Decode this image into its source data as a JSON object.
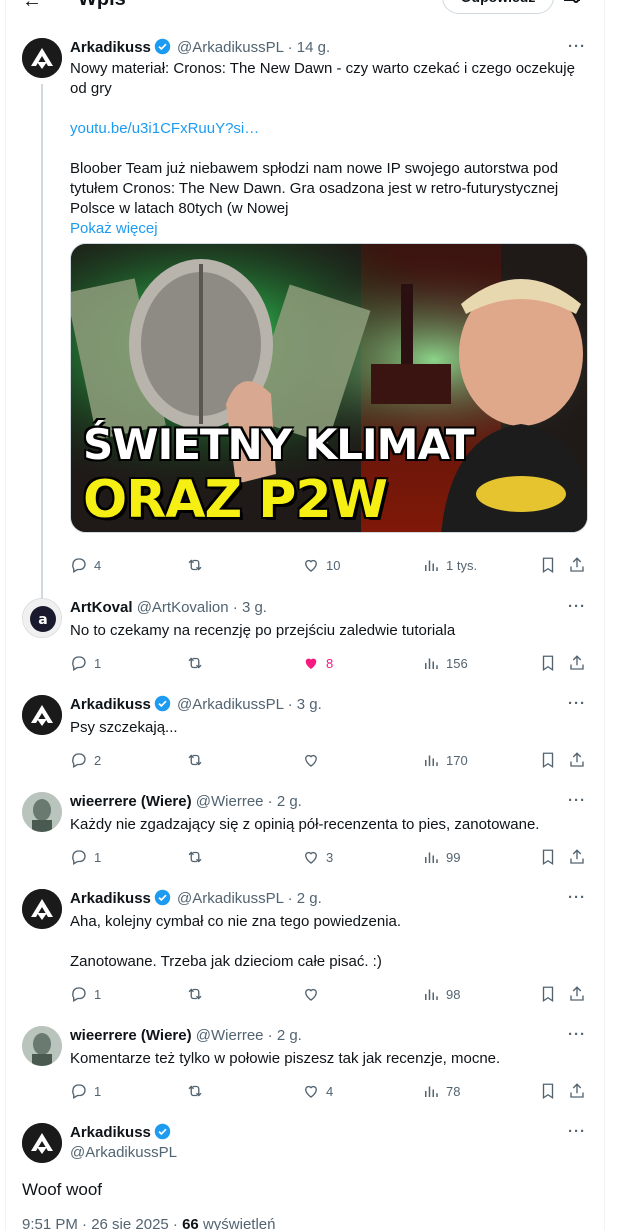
{
  "header": {
    "title": "Wpis",
    "reply_label": "Odpowiedz"
  },
  "icons": {
    "back": "arrow-left-icon",
    "adjust": "sliders-icon",
    "reply": "speech-bubble-icon",
    "repost": "repost-icon",
    "like": "heart-icon",
    "views": "bar-chart-icon",
    "bookmark": "bookmark-icon",
    "share": "share-icon"
  },
  "colors": {
    "accent": "#1d9bf0",
    "like": "#f91880",
    "muted": "#536471"
  },
  "tweets": [
    {
      "name": "Arkadikuss",
      "verified": true,
      "handle": "@ArkadikussPL",
      "time": "· 14 g.",
      "text1": "Nowy materiał: Cronos: The New Dawn - czy warto czekać i czego oczekuję od gry",
      "link": "youtu.be/u3i1CFxRuuY?si…",
      "text2": "Bloober Team już niebawem spłodzi nam nowe IP swojego autorstwa pod tytułem Cronos: The New Dawn. Gra osadzona jest w retro-futurystycznej Polsce w latach 80tych (w Nowej",
      "show_more": "Pokaż więcej",
      "image": {
        "line1": "ŚWIETNY KLIMAT",
        "line2": "ORAZ P2W"
      },
      "replies": "4",
      "reposts": "",
      "likes": "10",
      "views": "1 tys."
    },
    {
      "name": "ArtKoval",
      "verified": false,
      "handle": "@ArtKovalion",
      "time": "· 3 g.",
      "text": "No to czekamy na recenzję po przejściu zaledwie tutoriala",
      "replies": "1",
      "reposts": "",
      "likes": "8",
      "views": "156"
    },
    {
      "name": "Arkadikuss",
      "verified": true,
      "handle": "@ArkadikussPL",
      "time": "· 3 g.",
      "text": "Psy szczekają...",
      "replies": "2",
      "reposts": "",
      "likes": "",
      "views": "170"
    },
    {
      "name": "wieerrere (Wiere)",
      "verified": false,
      "handle": "@Wierree",
      "time": "· 2 g.",
      "text": "Każdy nie zgadzający się z opinią pół-recenzenta to pies, zanotowane.",
      "replies": "1",
      "reposts": "",
      "likes": "3",
      "views": "99"
    },
    {
      "name": "Arkadikuss",
      "verified": true,
      "handle": "@ArkadikussPL",
      "time": "· 2 g.",
      "text1": "Aha, kolejny cymbał co nie zna tego powiedzenia.",
      "text2": "Zanotowane. Trzeba jak dzieciom całe pisać. :)",
      "replies": "1",
      "reposts": "",
      "likes": "",
      "views": "98"
    },
    {
      "name": "wieerrere (Wiere)",
      "verified": false,
      "handle": "@Wierree",
      "time": "· 2 g.",
      "text": "Komentarze też tylko w połowie piszesz tak jak recenzje, mocne.",
      "replies": "1",
      "reposts": "",
      "likes": "4",
      "views": "78"
    }
  ],
  "main_tweet": {
    "name": "Arkadikuss",
    "handle": "@ArkadikussPL",
    "text": "Woof woof",
    "timestamp": "9:51 PM · 26 sie 2025 ·",
    "views_count": "66",
    "views_label": "wyświetleń"
  },
  "more_label": "···"
}
